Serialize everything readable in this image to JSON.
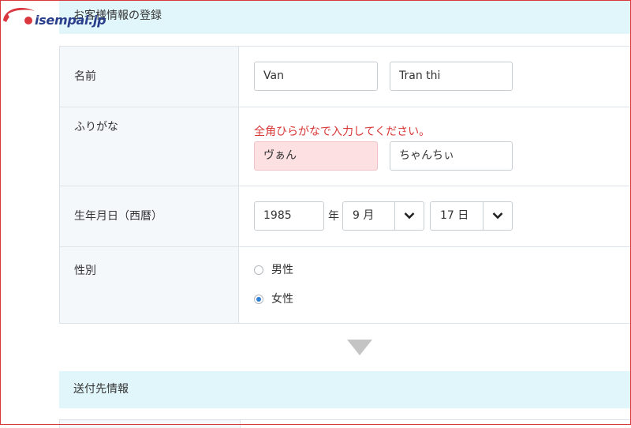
{
  "brand": {
    "logo_text": "isempai.jp",
    "accent": "#d9363e",
    "navy": "#2a3e8c"
  },
  "sections": {
    "customer": "お客様情報の登録",
    "shipping": "送付先情報"
  },
  "form": {
    "name": {
      "label": "名前",
      "first": "Van",
      "last": "Tran thi"
    },
    "furigana": {
      "label": "ふりがな",
      "error": "全角ひらがなで入力してください。",
      "first": "ヴぁん",
      "last": "ちゃんちぃ"
    },
    "birthday": {
      "label": "生年月日（西暦）",
      "year": "1985",
      "year_unit": "年",
      "month": "9 月",
      "day": "17 日"
    },
    "gender": {
      "label": "性別",
      "options": [
        {
          "label": "男性",
          "selected": false
        },
        {
          "label": "女性",
          "selected": true
        }
      ]
    }
  },
  "colors": {
    "header_bg": "#e1f6fb",
    "error": "#d93636",
    "error_bg": "#fde0e2",
    "radio_on": "#2d7fd1"
  }
}
